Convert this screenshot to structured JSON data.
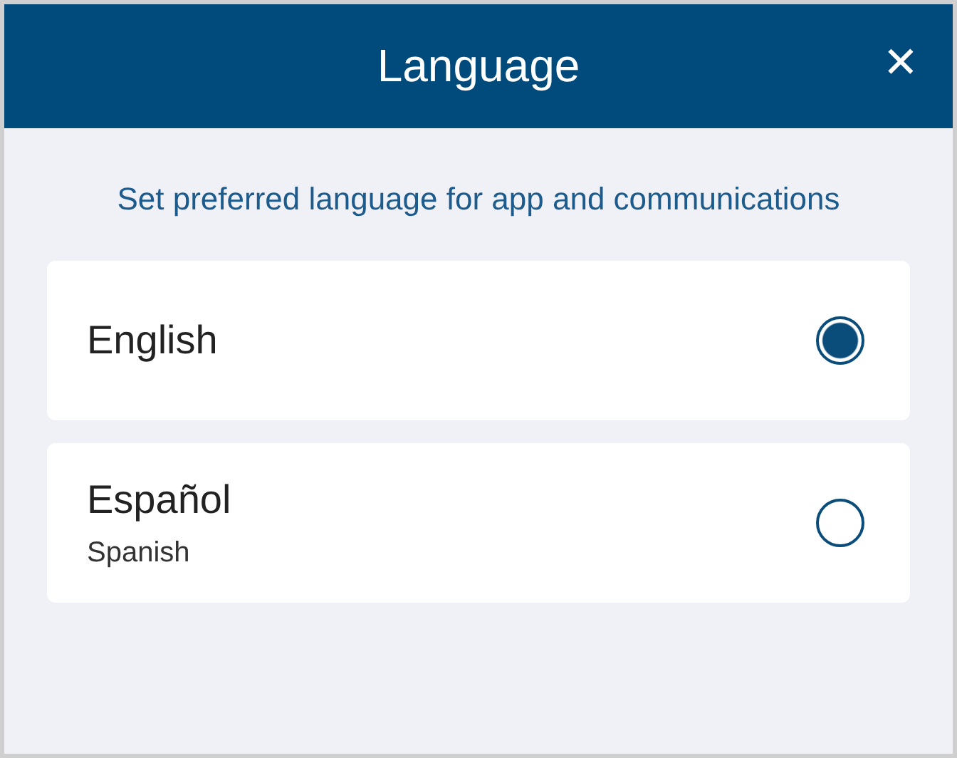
{
  "header": {
    "title": "Language",
    "close_icon": "✕"
  },
  "subtitle": "Set preferred language for app and communications",
  "options": [
    {
      "label": "English",
      "selected": true
    },
    {
      "label": "Español",
      "sublabel": "Spanish",
      "selected": false
    }
  ]
}
